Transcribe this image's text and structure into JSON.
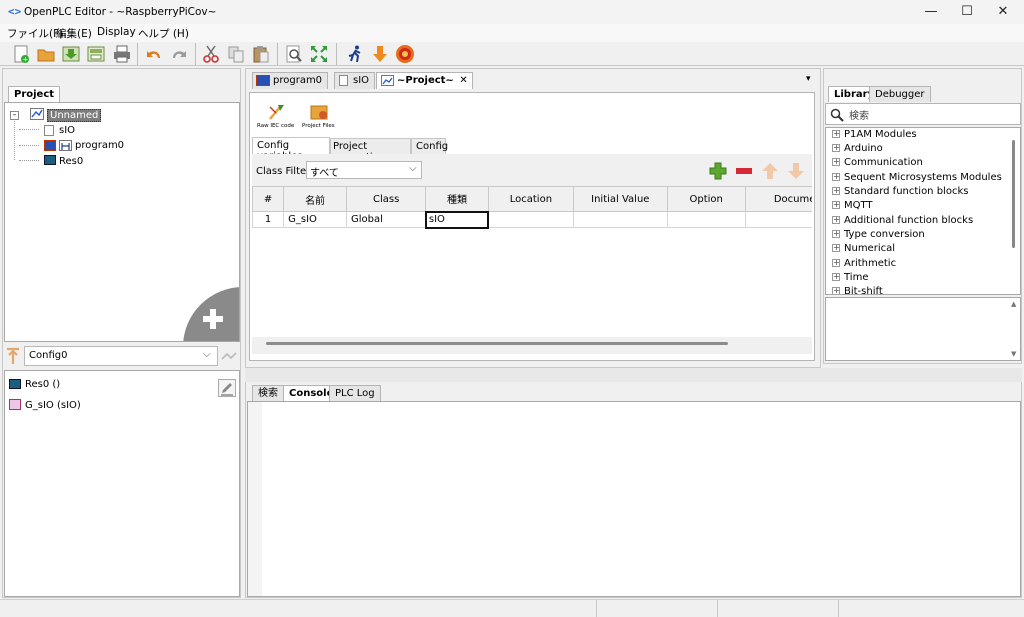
{
  "window": {
    "title": "OpenPLC Editor - ~RaspberryPiCov~",
    "min": "—",
    "max": "☐",
    "close": "✕"
  },
  "menu": [
    "ファイル(F)",
    "編集(E)",
    "Display",
    "ヘルプ (H)"
  ],
  "toolbar_icons": [
    "new-file",
    "open-folder",
    "save",
    "save-as",
    "print",
    "undo",
    "redo",
    "cut",
    "copy",
    "paste",
    "find",
    "zoom-fit",
    "run-simulation",
    "download",
    "start-plc"
  ],
  "left_panel": {
    "tab": "Project",
    "tree": {
      "root": "Unnamed",
      "children": [
        "sIO",
        "program0",
        "Res0"
      ]
    },
    "config_select": "Config0",
    "instances": [
      "Res0 ()",
      "G_sIO (sIO)"
    ]
  },
  "editor": {
    "tabs": [
      "program0",
      "sIO",
      "~Project~"
    ],
    "buttons": {
      "raw_iec": "Raw IEC code",
      "project_files": "Project Files"
    },
    "subtabs": [
      "Config variables",
      "Project properties",
      "Config"
    ],
    "class_filter_label": "Class Filter:",
    "class_filter_value": "すべて",
    "table": {
      "headers": [
        "#",
        "名前",
        "Class",
        "種類",
        "Location",
        "Initial Value",
        "Option",
        "Documentation"
      ],
      "rows": [
        [
          "1",
          "G_sIO",
          "Global",
          "sIO",
          "",
          "",
          "",
          ""
        ]
      ]
    }
  },
  "bottom_panel": {
    "tabs": [
      "検索",
      "Console",
      "PLC Log"
    ]
  },
  "library": {
    "tabs": [
      "Library",
      "Debugger"
    ],
    "search_placeholder": "検索",
    "items": [
      "P1AM Modules",
      "Arduino",
      "Communication",
      "Sequent Microsystems Modules",
      "Standard function blocks",
      "MQTT",
      "Additional function blocks",
      "Type conversion",
      "Numerical",
      "Arithmetic",
      "Time",
      "Bit-shift"
    ]
  }
}
